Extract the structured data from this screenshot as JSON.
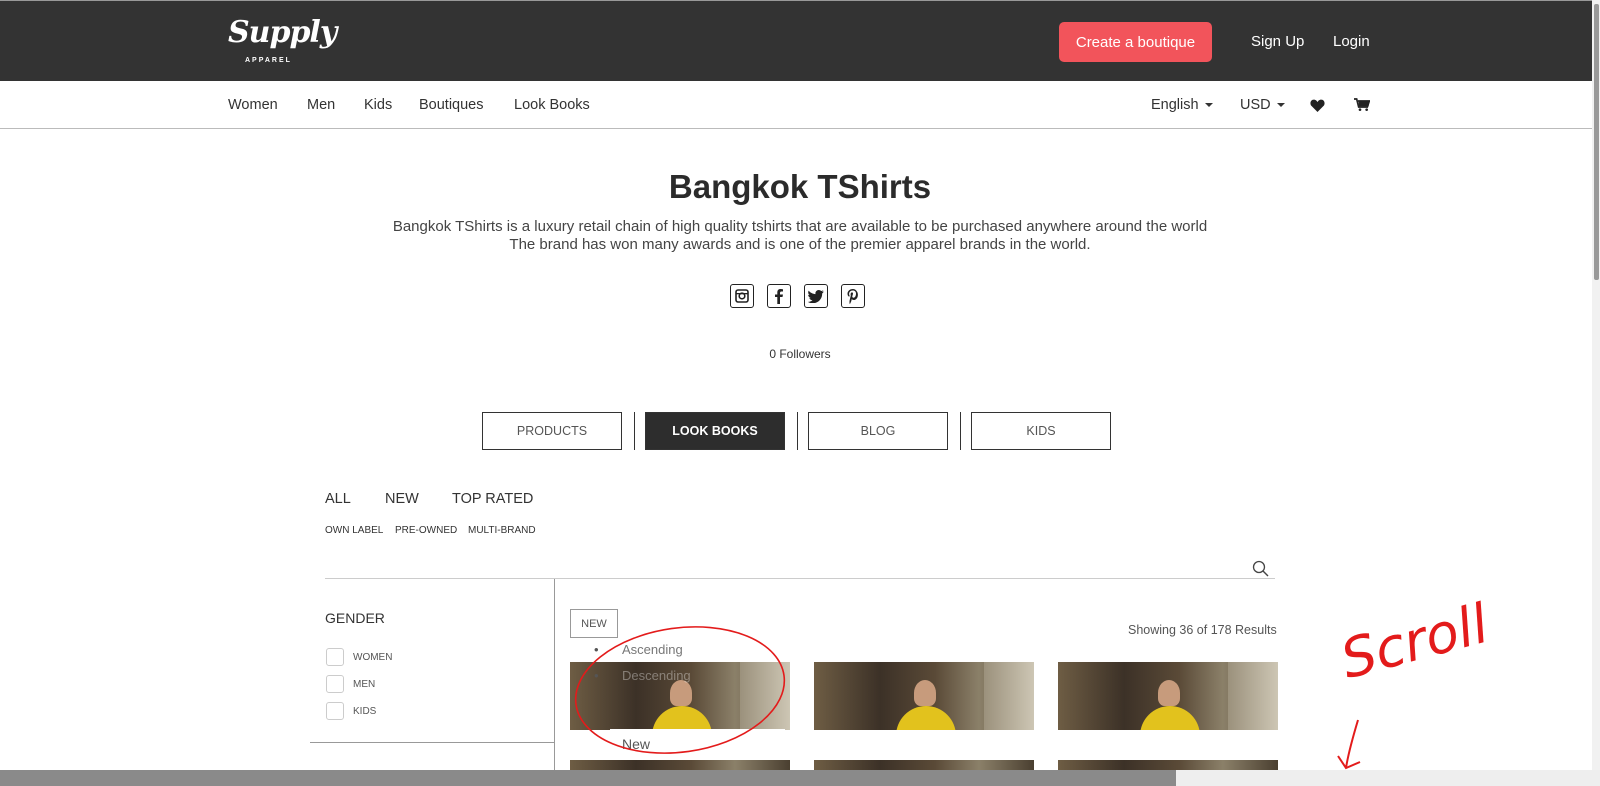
{
  "header": {
    "logo_text": "Supply",
    "logo_sub": "APPAREL",
    "create_label": "Create a boutique",
    "signup_label": "Sign Up",
    "login_label": "Login"
  },
  "nav": {
    "items": [
      "Women",
      "Men",
      "Kids",
      "Boutiques",
      "Look Books"
    ],
    "language": "English",
    "currency": "USD"
  },
  "boutique": {
    "title": "Bangkok TShirts",
    "desc_line1": "Bangkok TShirts is a luxury retail chain of high quality tshirts that are available to be purchased anywhere around the world",
    "desc_line2": "The brand has won many awards and is one of the premier apparel brands in the world.",
    "followers": "0 Followers"
  },
  "social": {
    "instagram": "instagram-icon",
    "facebook": "facebook-icon",
    "twitter": "twitter-icon",
    "pinterest": "pinterest-icon"
  },
  "tabs": [
    "PRODUCTS",
    "LOOK BOOKS",
    "BLOG",
    "KIDS"
  ],
  "active_tab": "LOOK BOOKS",
  "filters": {
    "main": [
      "ALL",
      "NEW",
      "TOP RATED"
    ],
    "sub": [
      "OWN LABEL",
      "PRE-OWNED",
      "MULTI-BRAND"
    ]
  },
  "sidebar": {
    "gender_title": "GENDER",
    "options": [
      "WOMEN",
      "MEN",
      "KIDS"
    ]
  },
  "listing": {
    "sort_value": "NEW",
    "results": "Showing 36 of 178 Results",
    "sort_options": [
      "Ascending",
      "Descending",
      "New"
    ],
    "selected_option": "New"
  },
  "annotation": {
    "text": "Scroll"
  },
  "colors": {
    "topbar": "#333333",
    "accent": "#f2545b",
    "annotation": "#e31b1b"
  }
}
